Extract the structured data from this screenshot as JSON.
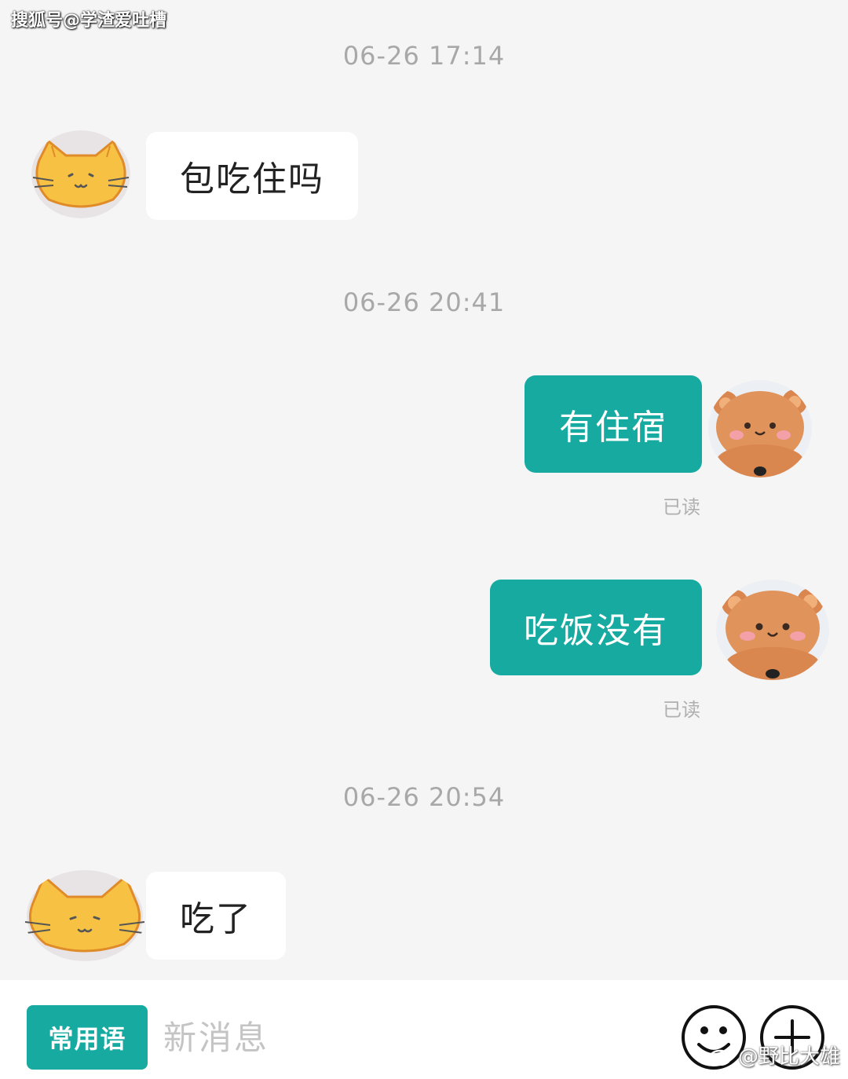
{
  "watermarks": {
    "top": "搜狐号@学渣爱吐槽",
    "bottom": "@野比大雄"
  },
  "chat": {
    "timestamps": [
      "06-26 17:14",
      "06-26 20:41",
      "06-26 20:54"
    ],
    "messages": [
      {
        "side": "in",
        "text": "包吃住吗"
      },
      {
        "side": "out",
        "text": "有住宿",
        "status": "已读"
      },
      {
        "side": "out",
        "text": "吃饭没有",
        "status": "已读"
      },
      {
        "side": "in",
        "text": "吃了"
      }
    ]
  },
  "input_bar": {
    "quick_phrase_label": "常用语",
    "input_placeholder": "新消息",
    "emoji_icon": "smiley-icon",
    "plus_icon": "plus-icon"
  },
  "colors": {
    "background": "#f5f5f5",
    "accent": "#16aaa1",
    "incoming_bubble": "#ffffff",
    "timestamp_text": "#a8a8a8"
  }
}
